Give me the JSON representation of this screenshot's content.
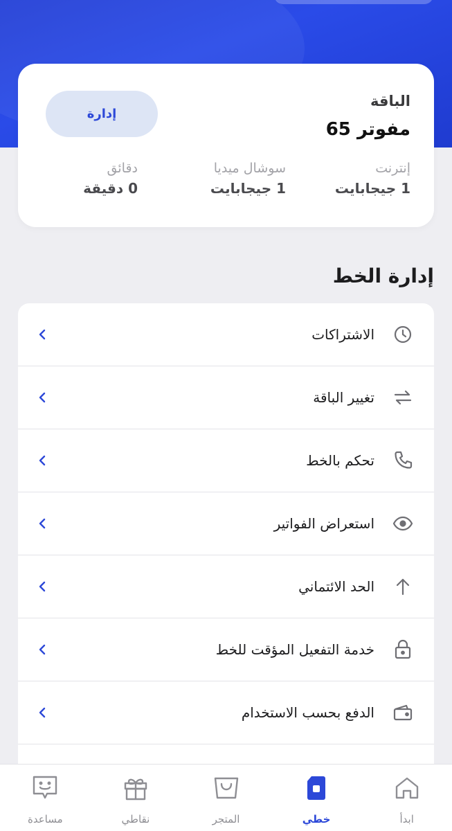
{
  "plan": {
    "label": "الباقة",
    "name": "مفوتر 65",
    "manage_label": "إدارة",
    "stats": [
      {
        "label": "إنترنت",
        "value": "1 جيجابايت"
      },
      {
        "label": "سوشال ميديا",
        "value": "1 جيجابايت"
      },
      {
        "label": "دقائق",
        "value": "0 دقيقة"
      }
    ]
  },
  "line_management": {
    "title": "إدارة الخط",
    "items": [
      {
        "label": "الاشتراكات",
        "icon": "clock-icon"
      },
      {
        "label": "تغيير الباقة",
        "icon": "swap-arrows-icon"
      },
      {
        "label": "تحكم بالخط",
        "icon": "phone-icon"
      },
      {
        "label": "استعراض الفواتير",
        "icon": "eye-icon"
      },
      {
        "label": "الحد الائتماني",
        "icon": "arrow-up-icon"
      },
      {
        "label": "خدمة التفعيل المؤقت للخط",
        "icon": "lock-icon"
      },
      {
        "label": "الدفع بحسب الاستخدام",
        "icon": "wallet-icon"
      }
    ]
  },
  "tabbar": {
    "active": "line",
    "tabs": [
      {
        "key": "start",
        "label": "ابدأ",
        "icon": "home-icon"
      },
      {
        "key": "line",
        "label": "خطي",
        "icon": "sim-card-icon"
      },
      {
        "key": "store",
        "label": "المتجر",
        "icon": "shopping-bag-icon"
      },
      {
        "key": "points",
        "label": "نقاطي",
        "icon": "gift-icon"
      },
      {
        "key": "help",
        "label": "مساعدة",
        "icon": "chat-smile-icon"
      }
    ]
  },
  "colors": {
    "brand": "#2c48d8",
    "hero": "#2a4be8",
    "background": "#eeeef2",
    "manage_button_bg": "#dde5f5"
  }
}
